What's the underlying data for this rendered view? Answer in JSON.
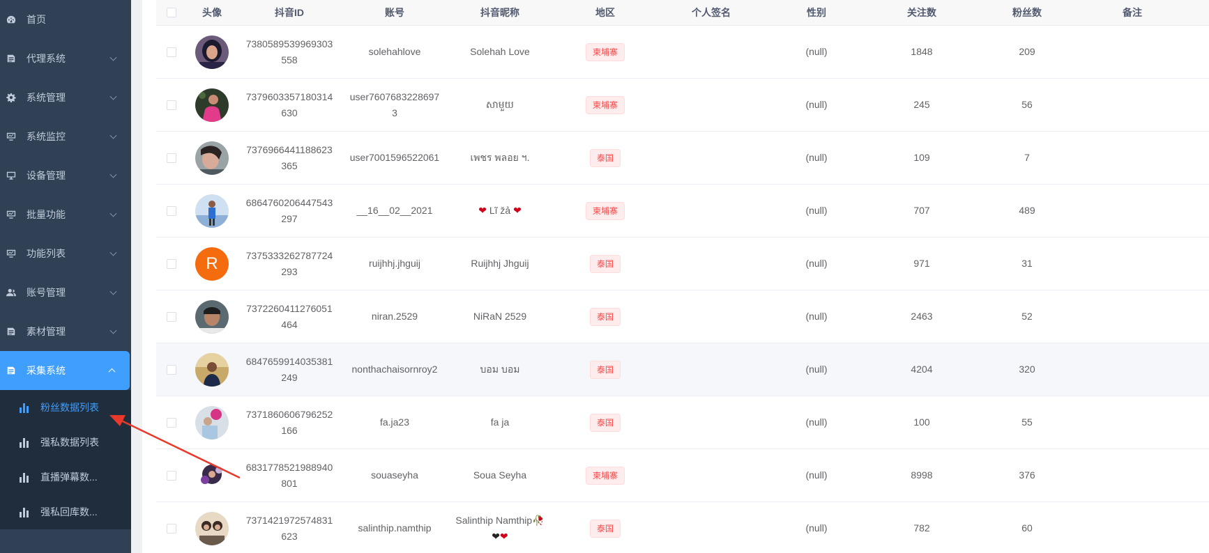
{
  "sidebar": {
    "items": [
      {
        "label": "首页",
        "icon": "dashboard-icon"
      },
      {
        "label": "代理系统",
        "icon": "document-icon"
      },
      {
        "label": "系统管理",
        "icon": "gear-icon"
      },
      {
        "label": "系统监控",
        "icon": "monitor-icon"
      },
      {
        "label": "设备管理",
        "icon": "monitor-icon"
      },
      {
        "label": "批量功能",
        "icon": "monitor-icon"
      },
      {
        "label": "功能列表",
        "icon": "monitor-icon"
      },
      {
        "label": "账号管理",
        "icon": "user-icon"
      },
      {
        "label": "素材管理",
        "icon": "document-icon"
      },
      {
        "label": "采集系统",
        "icon": "document-icon"
      }
    ],
    "submenu": [
      {
        "label": "粉丝数据列表",
        "icon": "bar-chart-icon"
      },
      {
        "label": "强私数据列表",
        "icon": "bar-chart-icon"
      },
      {
        "label": "直播弹幕数...",
        "icon": "bar-chart-icon"
      },
      {
        "label": "强私回库数...",
        "icon": "bar-chart-icon"
      }
    ]
  },
  "table": {
    "headers": {
      "avatar": "头像",
      "douyin_id": "抖音ID",
      "account": "账号",
      "nickname": "抖音昵称",
      "region": "地区",
      "signature": "个人签名",
      "gender": "性别",
      "following": "关注数",
      "fans": "粉丝数",
      "note": "备注"
    },
    "rows": [
      {
        "id": "7380589539969303558",
        "account": "solehahlove",
        "nickname": "Solehah Love",
        "region": "柬埔寨",
        "signature": "",
        "gender": "(null)",
        "following": "1848",
        "fans": "209",
        "note": ""
      },
      {
        "id": "7379603357180314630",
        "account": "user76076832286973",
        "nickname": "សាមួយ",
        "region": "柬埔寨",
        "signature": "",
        "gender": "(null)",
        "following": "245",
        "fans": "56",
        "note": ""
      },
      {
        "id": "7376966441188623365",
        "account": "user7001596522061",
        "nickname": "เพชร พลอย ฯ.",
        "region": "泰国",
        "signature": "",
        "gender": "(null)",
        "following": "109",
        "fans": "7",
        "note": ""
      },
      {
        "id": "6864760206447543297",
        "account": "__16__02__2021",
        "nickname": "Lĩ žả",
        "region": "柬埔寨",
        "signature": "",
        "gender": "(null)",
        "following": "707",
        "fans": "489",
        "note": ""
      },
      {
        "id": "7375333262787724293",
        "account": "ruijhhj.jhguij",
        "nickname": "Ruijhhj Jhguij",
        "region": "泰国",
        "signature": "",
        "gender": "(null)",
        "following": "971",
        "fans": "31",
        "note": "",
        "avatar_letter": "R"
      },
      {
        "id": "7372260411276051464",
        "account": "niran.2529",
        "nickname": "NiRaN 2529",
        "region": "泰国",
        "signature": "",
        "gender": "(null)",
        "following": "2463",
        "fans": "52",
        "note": ""
      },
      {
        "id": "6847659914035381249",
        "account": "nonthachaisornroy2",
        "nickname": "บอม บอม",
        "region": "泰国",
        "signature": "",
        "gender": "(null)",
        "following": "4204",
        "fans": "320",
        "note": ""
      },
      {
        "id": "7371860606796252166",
        "account": "fa.ja23",
        "nickname": "fa ja",
        "region": "泰国",
        "signature": "",
        "gender": "(null)",
        "following": "100",
        "fans": "55",
        "note": ""
      },
      {
        "id": "6831778521988940801",
        "account": "souaseyha",
        "nickname": "Soua Seyha",
        "region": "柬埔寨",
        "signature": "",
        "gender": "(null)",
        "following": "8998",
        "fans": "376",
        "note": ""
      },
      {
        "id": "7371421972574831623",
        "account": "salinthip.namthip",
        "nickname": "Salinthip Namthip",
        "region": "泰国",
        "signature": "",
        "gender": "(null)",
        "following": "782",
        "fans": "60",
        "note": ""
      }
    ]
  },
  "colors": {
    "sidebar_bg": "#304156",
    "submenu_bg": "#1f2d3d",
    "accent": "#409eff",
    "tag_text": "#ff4949",
    "annotation_arrow": "#e8392b"
  }
}
